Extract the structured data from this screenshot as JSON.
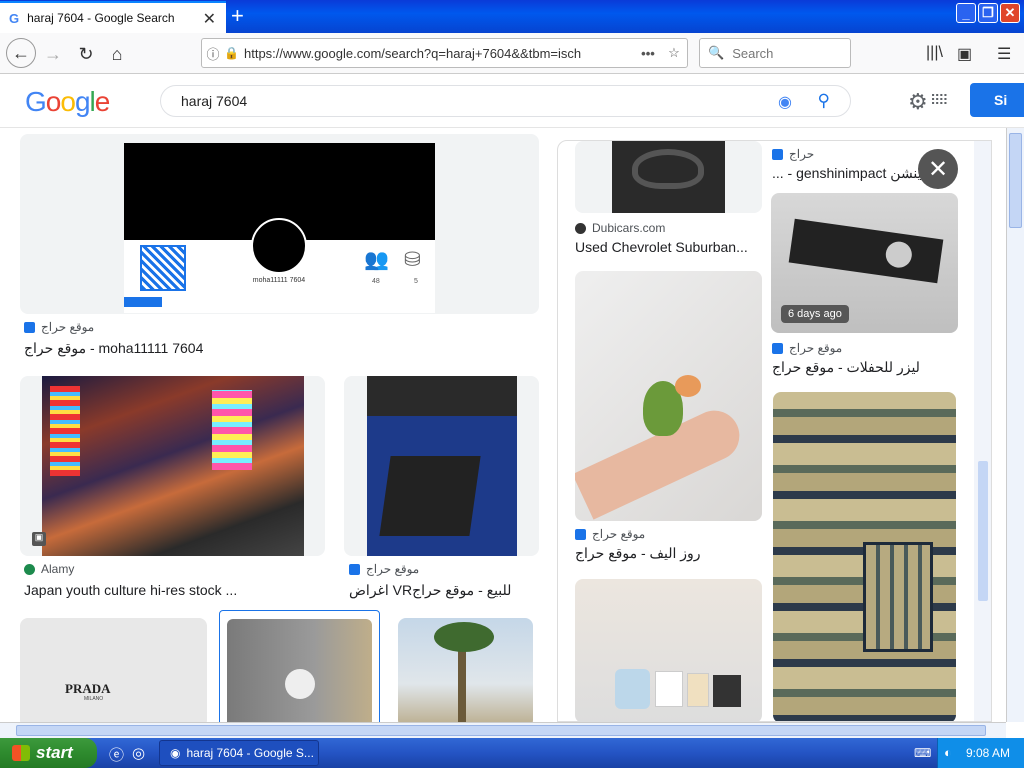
{
  "browser": {
    "tab_title": "haraj 7604 - Google Search",
    "tab_favicon": "G",
    "url": "https://www.google.com/search?q=haraj+7604&&tbm=isch",
    "search_placeholder": "Search"
  },
  "google": {
    "query": "haraj 7604",
    "signin_label": "Si"
  },
  "results": {
    "r1": {
      "source": "موقع حراج",
      "title": "موقع حراج - moha11111 7604",
      "caption": "moha11111 7604",
      "stat1": "48",
      "stat2": "5"
    },
    "r2": {
      "source": "Alamy",
      "title": "Japan youth culture hi-res stock ..."
    },
    "r3": {
      "source": "موقع حراج",
      "title": "اغراض VRللبيع - موقع حراج"
    },
    "r4": {
      "brand": "PRADA",
      "brand_sub": "MILANO"
    }
  },
  "panel": {
    "p1": {
      "source": "Dubicars.com",
      "title": "Used Chevrolet Suburban..."
    },
    "p2": {
      "source": "موقع حراج",
      "title": "روز اليف - موقع حراج"
    },
    "p3": {
      "source": "حراج",
      "title": "... - genshinimpact جينشن"
    },
    "p4": {
      "badge": "6 days ago",
      "source": "موقع حراج",
      "title": "ليزر للحفلات - موقع حراج"
    }
  },
  "taskbar": {
    "start_label": "start",
    "task_label": "haraj 7604 - Google S...",
    "clock": "9:08 AM"
  }
}
